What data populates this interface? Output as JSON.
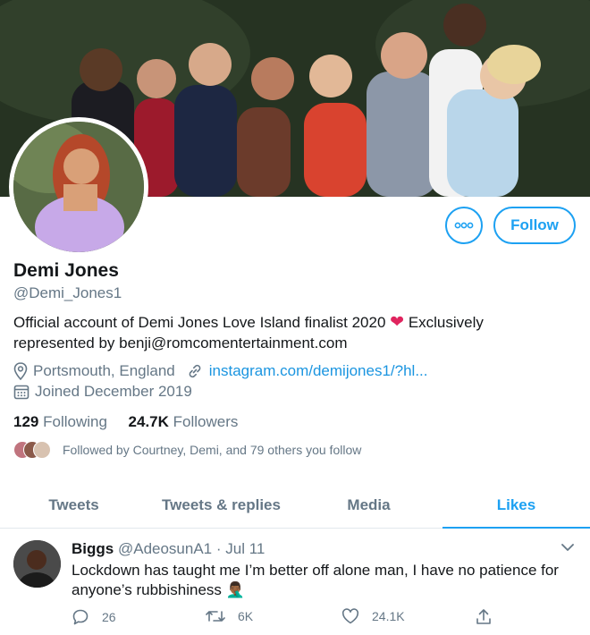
{
  "profile": {
    "name": "Demi Jones",
    "handle": "@Demi_Jones1",
    "bio_part1": "Official account of Demi Jones Love Island finalist 2020",
    "bio_heart": "❤",
    "bio_part2": "Exclusively represented by benji@romcomentertainment.com",
    "location": "Portsmouth, England",
    "website": "instagram.com/demijones1/?hl...",
    "joined": "Joined December 2019",
    "following_count": "129",
    "following_label": "Following",
    "followers_count": "24.7K",
    "followers_label": "Followers",
    "followed_by": "Followed by Courtney, Demi, and 79 others you follow"
  },
  "actions": {
    "follow_label": "Follow",
    "more_icon": "more-icon"
  },
  "tabs": [
    {
      "label": "Tweets"
    },
    {
      "label": "Tweets & replies"
    },
    {
      "label": "Media"
    },
    {
      "label": "Likes"
    }
  ],
  "active_tab": "Likes",
  "tweet": {
    "name": "Biggs",
    "handle": "@AdeosunA1",
    "separator": "·",
    "date": "Jul 11",
    "text": "Lockdown has taught me I’m better off alone man, I have no patience for anyone’s rubbishiness 🤦🏾‍♂️",
    "replies": "26",
    "retweets": "6K",
    "likes": "24.1K"
  },
  "colors": {
    "accent": "#1da1f2",
    "heart": "#e0245e",
    "muted": "#657786",
    "text": "#14171a"
  }
}
